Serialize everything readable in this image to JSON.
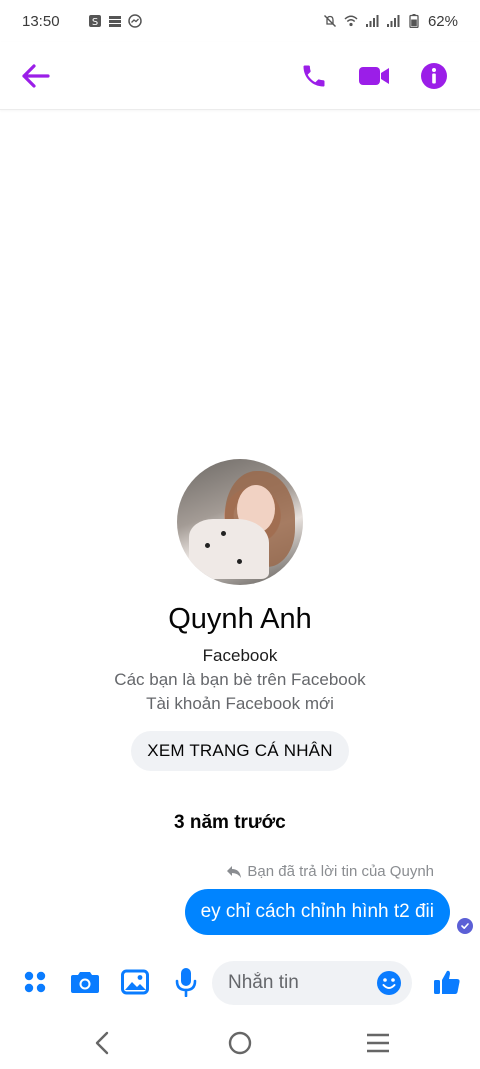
{
  "status_bar": {
    "time": "13:50",
    "battery": "62%",
    "icons": [
      "s-app-icon",
      "stack-icon",
      "messenger-icon",
      "mute-icon",
      "wifi-icon",
      "signal-icon",
      "signal-icon",
      "battery-icon"
    ]
  },
  "header": {
    "back_icon": "arrow-left-icon",
    "actions": [
      "phone-icon",
      "video-camera-icon",
      "info-icon"
    ]
  },
  "profile": {
    "name": "Quynh Anh",
    "platform": "Facebook",
    "friends_note": "Các bạn là bạn bè trên Facebook",
    "account_note": "Tài khoản Facebook mới",
    "view_profile_label": "XEM TRANG CÁ NHÂN"
  },
  "conversation": {
    "timestamp": "3 năm trước",
    "reply_note": "Bạn đã trả lời tin của Quynh",
    "messages": [
      {
        "sender": "me",
        "text": "ey chỉ cách chỉnh hình t2 đii",
        "status": "seen"
      }
    ]
  },
  "composer": {
    "placeholder": "Nhắn tin",
    "buttons": [
      "apps-icon",
      "camera-icon",
      "image-icon",
      "mic-icon",
      "emoji-icon",
      "thumbs-up-icon"
    ]
  },
  "nav": [
    "back-icon",
    "home-icon",
    "recents-icon"
  ],
  "colors": {
    "accent": "#9b1ee8",
    "bubble": "#0084ff",
    "composer_icon": "#0a7cff",
    "seen": "#5b5fd6"
  }
}
